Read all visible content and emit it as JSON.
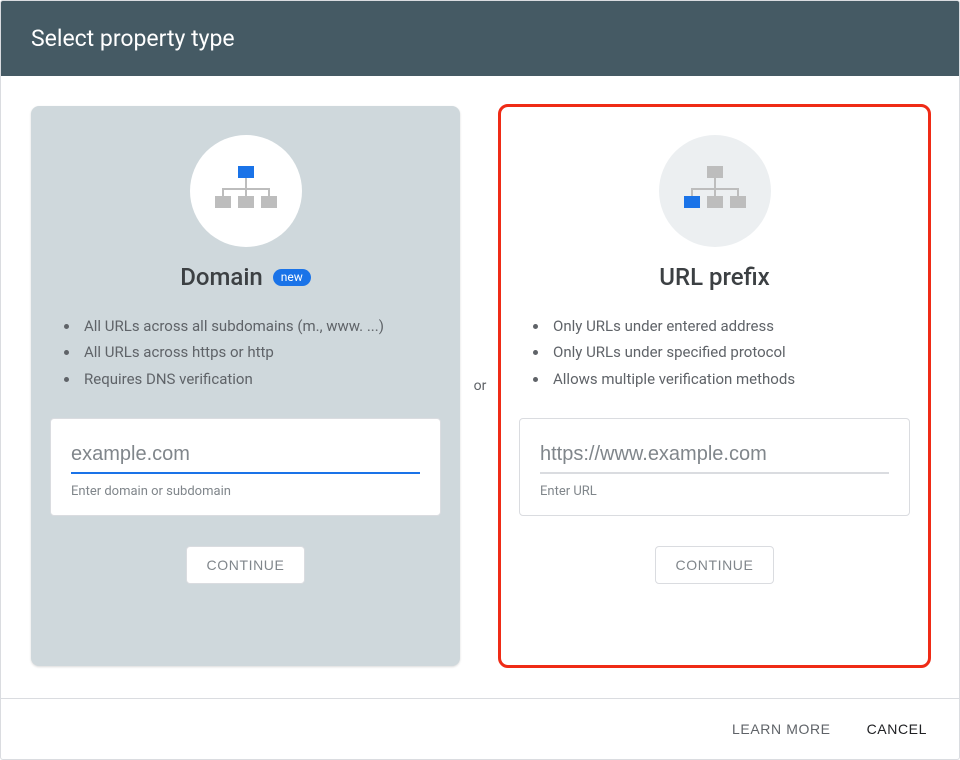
{
  "header": {
    "title": "Select property type"
  },
  "separator_label": "or",
  "domain_card": {
    "title": "Domain",
    "badge": "new",
    "bullets": [
      "All URLs across all subdomains (m., www. ...)",
      "All URLs across https or http",
      "Requires DNS verification"
    ],
    "input_placeholder": "example.com",
    "input_helper": "Enter domain or subdomain",
    "continue_label": "CONTINUE"
  },
  "urlprefix_card": {
    "title": "URL prefix",
    "bullets": [
      "Only URLs under entered address",
      "Only URLs under specified protocol",
      "Allows multiple verification methods"
    ],
    "input_placeholder": "https://www.example.com",
    "input_helper": "Enter URL",
    "continue_label": "CONTINUE"
  },
  "footer": {
    "learn_more": "LEARN MORE",
    "cancel": "CANCEL"
  }
}
